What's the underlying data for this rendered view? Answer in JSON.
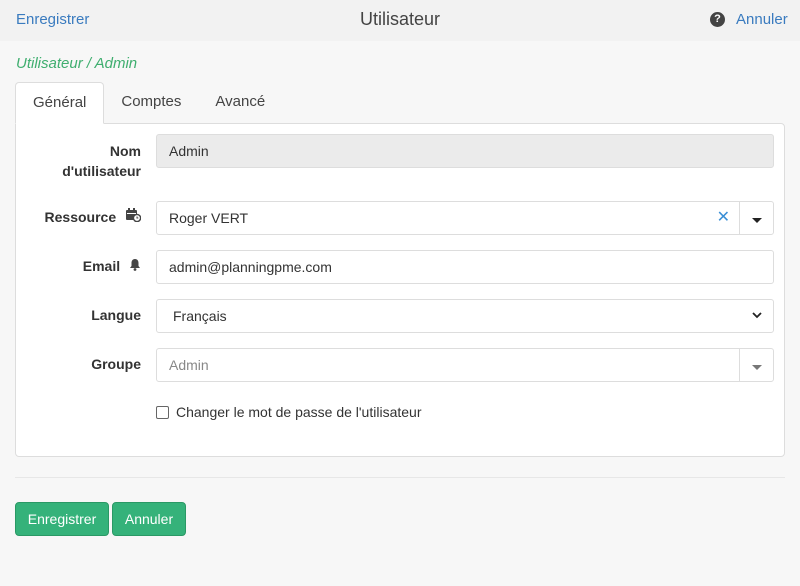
{
  "header": {
    "save_label": "Enregistrer",
    "title": "Utilisateur",
    "help_icon": "?",
    "cancel_label": "Annuler"
  },
  "breadcrumb": "Utilisateur / Admin",
  "tabs": [
    {
      "label": "Général",
      "active": true
    },
    {
      "label": "Comptes",
      "active": false
    },
    {
      "label": "Avancé",
      "active": false
    }
  ],
  "form": {
    "username": {
      "label_line1": "Nom",
      "label_line2": "d'utilisateur",
      "value": "Admin"
    },
    "resource": {
      "label": "Ressource",
      "icon": "calendar-clock-icon",
      "value": "Roger VERT",
      "clear": "✕"
    },
    "email": {
      "label": "Email",
      "icon": "bell-icon",
      "value": "admin@planningpme.com"
    },
    "language": {
      "label": "Langue",
      "value": "Français"
    },
    "group": {
      "label": "Groupe",
      "value": "Admin"
    },
    "change_password": {
      "label": "Changer le mot de passe de l'utilisateur",
      "checked": false
    }
  },
  "footer": {
    "save_label": "Enregistrer",
    "cancel_label": "Annuler"
  },
  "colors": {
    "accent_link": "#3a7bbf",
    "breadcrumb": "#3fae6f",
    "button": "#35b27a"
  }
}
